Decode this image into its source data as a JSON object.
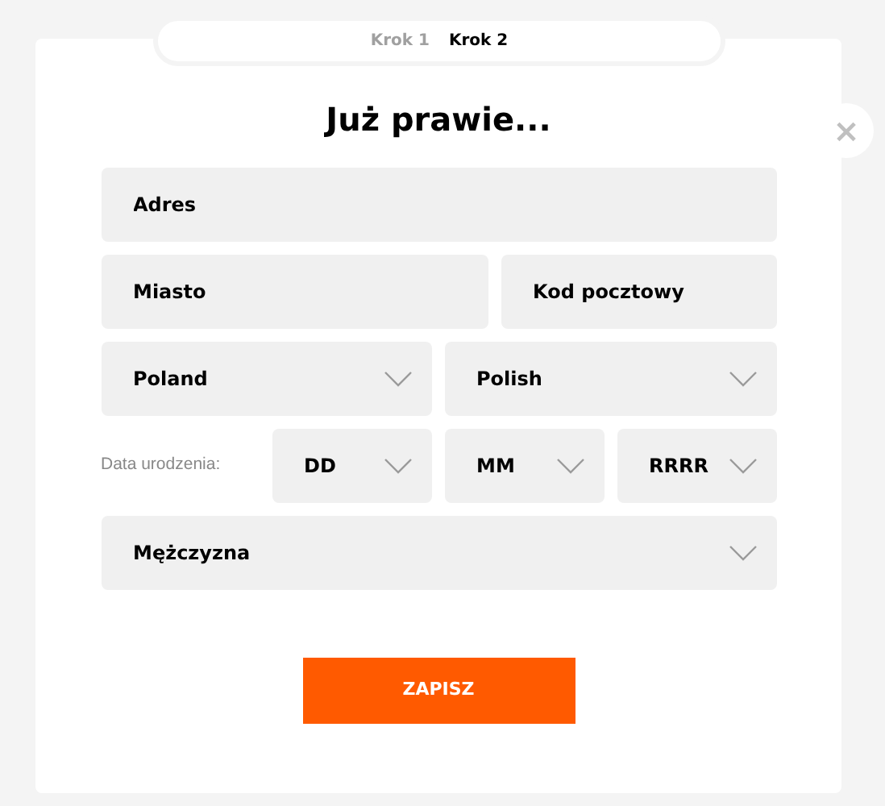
{
  "steps": [
    {
      "label": "Krok 1",
      "selected": false
    },
    {
      "label": "Krok 2",
      "selected": true
    }
  ],
  "close": {
    "label": "×"
  },
  "title": "Już prawie...",
  "address": {
    "placeholder": "Adres"
  },
  "city": {
    "placeholder": "Miasto"
  },
  "postal_code": {
    "placeholder": "Kod pocztowy"
  },
  "country": {
    "value": "Poland"
  },
  "language": {
    "value": "Polish"
  },
  "birth_date": {
    "label": "Data urodzenia:",
    "day": "DD",
    "month": "MM",
    "year": "RRRR"
  },
  "gender": {
    "value": "Mężczyzna"
  },
  "submit": "ZAPISZ"
}
